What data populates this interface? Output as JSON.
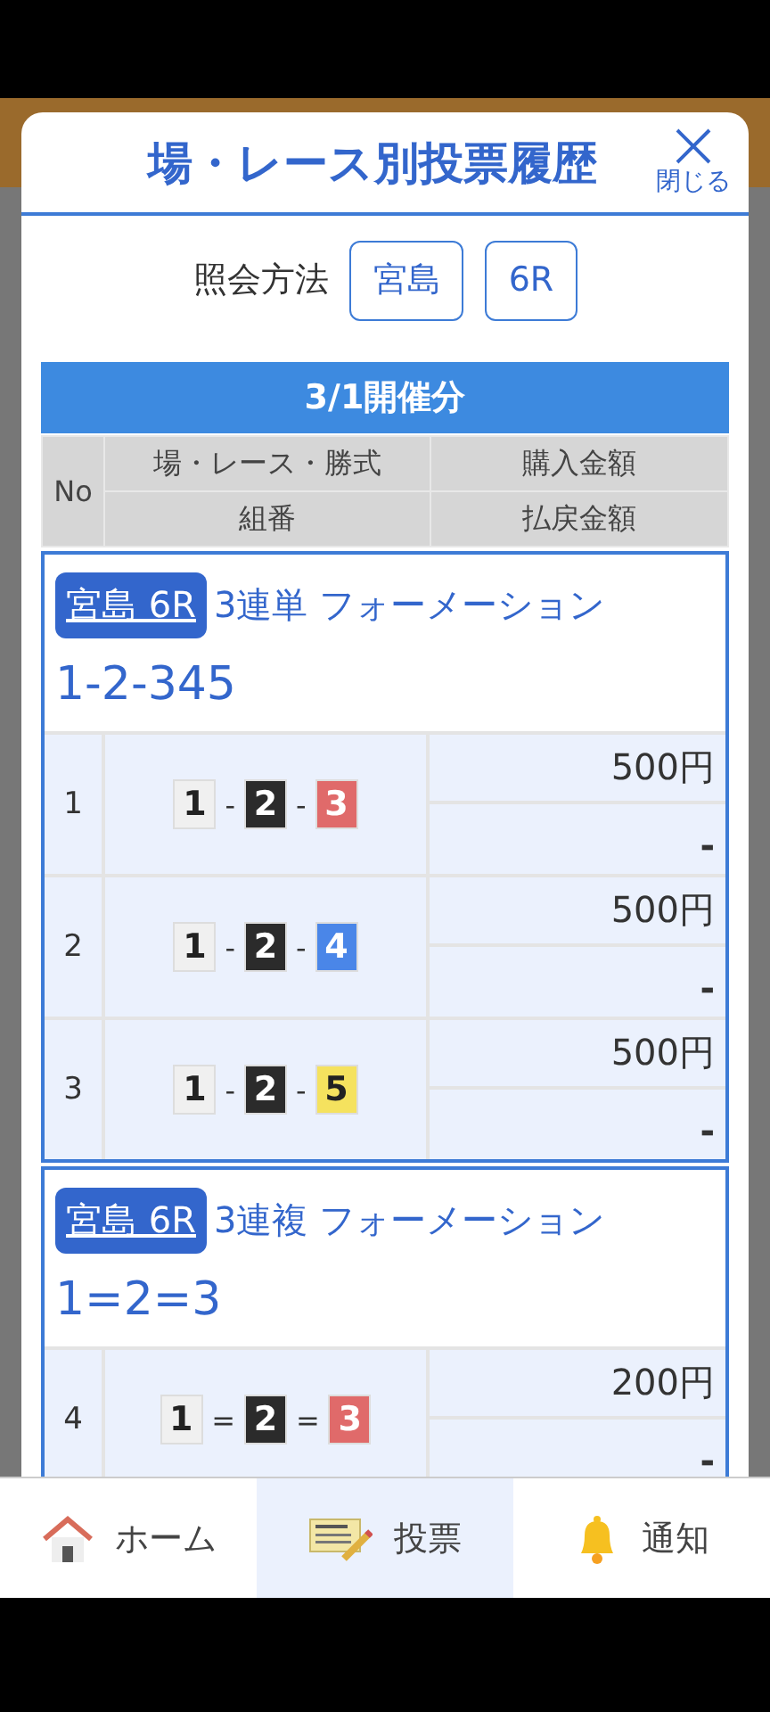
{
  "dialog": {
    "title": "場・レース別投票履歴",
    "close_label": "閉じる"
  },
  "query": {
    "label": "照会方法",
    "buttons": [
      "宮島",
      "6R"
    ]
  },
  "table": {
    "date_title": "3/1開催分",
    "columns": {
      "no": "No",
      "race": "場・レース・勝式",
      "combo": "組番",
      "amount": "購入金額",
      "payout": "払戻金額"
    },
    "groups": [
      {
        "venue": "宮島 6R",
        "bet_type": "3連単 フォーメーション",
        "combination": "1-2-345",
        "rows": [
          {
            "no": "1",
            "separator": "-",
            "boats": [
              {
                "number": "1",
                "color": "#f0f0f0"
              },
              {
                "number": "2",
                "color": "#2b2b2b"
              },
              {
                "number": "3",
                "color": "#e06a6a"
              }
            ],
            "amount": "500円",
            "payout": "-"
          },
          {
            "no": "2",
            "separator": "-",
            "boats": [
              {
                "number": "1",
                "color": "#f0f0f0"
              },
              {
                "number": "2",
                "color": "#2b2b2b"
              },
              {
                "number": "4",
                "color": "#4a86e8"
              }
            ],
            "amount": "500円",
            "payout": "-"
          },
          {
            "no": "3",
            "separator": "-",
            "boats": [
              {
                "number": "1",
                "color": "#f0f0f0"
              },
              {
                "number": "2",
                "color": "#2b2b2b"
              },
              {
                "number": "5",
                "color": "#f5e25e"
              }
            ],
            "amount": "500円",
            "payout": "-"
          }
        ]
      },
      {
        "venue": "宮島 6R",
        "bet_type": "3連複 フォーメーション",
        "combination": "1=2=3",
        "rows": [
          {
            "no": "4",
            "separator": "=",
            "boats": [
              {
                "number": "1",
                "color": "#f0f0f0"
              },
              {
                "number": "2",
                "color": "#2b2b2b"
              },
              {
                "number": "3",
                "color": "#e06a6a"
              }
            ],
            "amount": "200円",
            "payout": "-"
          }
        ]
      }
    ]
  },
  "nav": [
    {
      "kind": "home",
      "label": "ホーム",
      "selected": false
    },
    {
      "kind": "vote",
      "label": "投票",
      "selected": true
    },
    {
      "kind": "bell",
      "label": "通知",
      "selected": false
    }
  ]
}
